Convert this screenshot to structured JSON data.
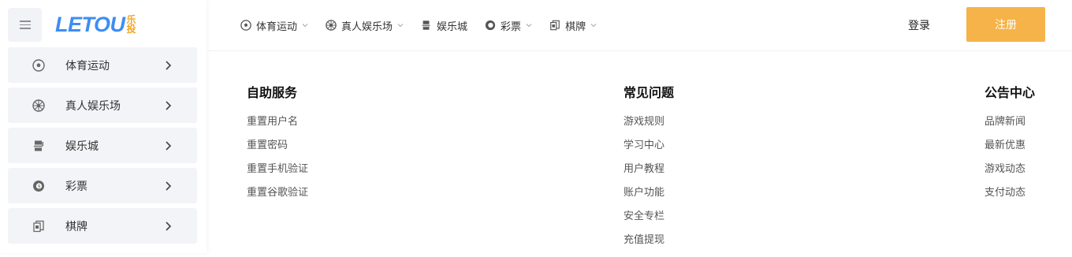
{
  "logo": {
    "word_left": "LET",
    "word_right": "OU",
    "cn_top": "乐",
    "cn_bottom": "投"
  },
  "sidebar": {
    "items": [
      {
        "label": "体育运动",
        "icon": "soccer-ball-icon"
      },
      {
        "label": "真人娱乐场",
        "icon": "roulette-icon"
      },
      {
        "label": "娱乐城",
        "icon": "slot-machine-icon"
      },
      {
        "label": "彩票",
        "icon": "lottery-ball-icon"
      },
      {
        "label": "棋牌",
        "icon": "cards-icon"
      }
    ]
  },
  "topnav": {
    "items": [
      {
        "label": "体育运动",
        "has_caret": true
      },
      {
        "label": "真人娱乐场",
        "has_caret": true
      },
      {
        "label": "娱乐城",
        "has_caret": false
      },
      {
        "label": "彩票",
        "has_caret": true
      },
      {
        "label": "棋牌",
        "has_caret": true
      }
    ],
    "login_label": "登录",
    "register_label": "注册"
  },
  "menu": {
    "self_service": {
      "title": "自助服务",
      "links": [
        "重置用户名",
        "重置密码",
        "重置手机验证",
        "重置谷歌验证"
      ]
    },
    "faq": {
      "title": "常见问题",
      "links": [
        "游戏规则",
        "学习中心",
        "用户教程",
        "账户功能",
        "安全专栏",
        "充值提现"
      ]
    },
    "announcements": {
      "title": "公告中心",
      "links": [
        "品牌新闻",
        "最新优惠",
        "游戏动态",
        "支付动态"
      ]
    }
  },
  "colors": {
    "brand_blue": "#3d8ef2",
    "brand_orange": "#f5a623",
    "register_bg": "#f5b349",
    "sidebar_item_bg": "#f2f4f7"
  }
}
